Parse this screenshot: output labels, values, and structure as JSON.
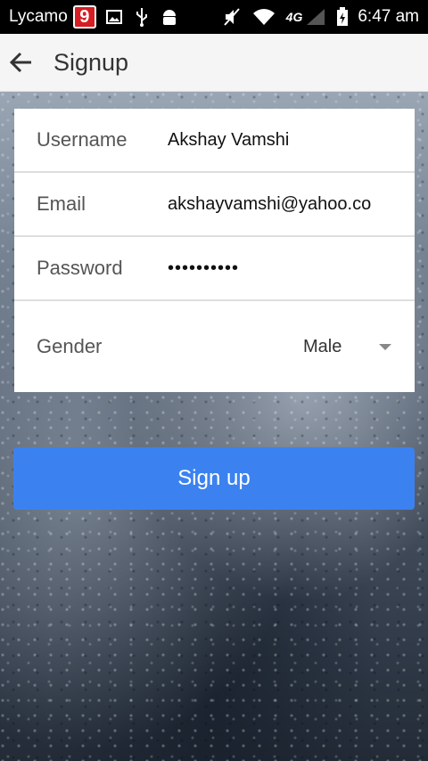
{
  "status_bar": {
    "carrier": "Lycamo",
    "badge": "9",
    "network": "4G",
    "time": "6:47 am"
  },
  "app_bar": {
    "title": "Signup"
  },
  "form": {
    "username": {
      "label": "Username",
      "value": "Akshay Vamshi"
    },
    "email": {
      "label": "Email",
      "value": "akshayvamshi@yahoo.co"
    },
    "password": {
      "label": "Password",
      "value": "••••••••••"
    },
    "gender": {
      "label": "Gender",
      "value": "Male"
    }
  },
  "signup_button": {
    "label": "Sign up"
  },
  "colors": {
    "primary_button": "#3b82f0",
    "status_bar": "#000000",
    "app_bar": "#f5f5f5"
  },
  "icons": {
    "back": "arrow-left-icon",
    "dropdown": "triangle-down-icon"
  }
}
